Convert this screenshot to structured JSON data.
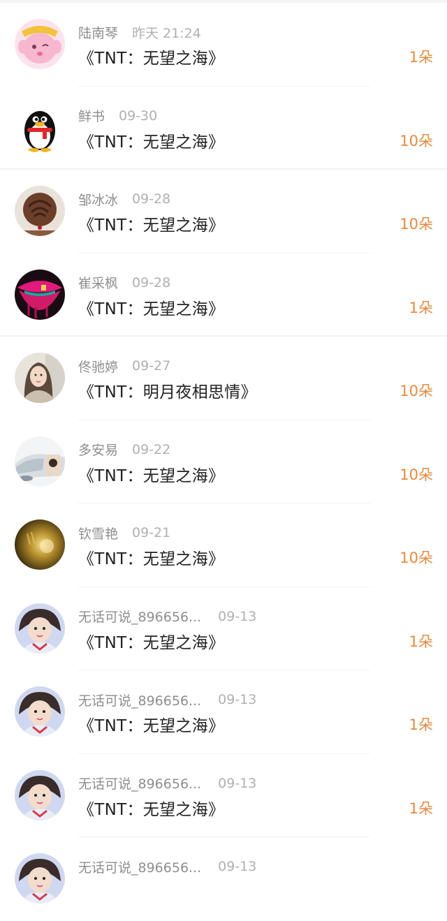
{
  "items": [
    {
      "name": "陆南琴",
      "date": "昨天 21:24",
      "title": "《TNT：无望之海》",
      "count": "1朵",
      "avatar": "pink-cartoon-avatar"
    },
    {
      "name": "鲜书",
      "date": "09-30",
      "title": "《TNT：无望之海》",
      "count": "10朵",
      "avatar": "qq-penguin-avatar"
    },
    {
      "name": "邹冰冰",
      "date": "09-28",
      "title": "《TNT：无望之海》",
      "count": "10朵",
      "avatar": "brown-rose-avatar"
    },
    {
      "name": "崔采枫",
      "date": "09-28",
      "title": "《TNT：无望之海》",
      "count": "1朵",
      "avatar": "pink-lips-avatar"
    },
    {
      "name": "佟驰婷",
      "date": "09-27",
      "title": "《TNT：明月夜相思情》",
      "count": "10朵",
      "avatar": "girl-photo-avatar"
    },
    {
      "name": "多安易",
      "date": "09-22",
      "title": "《TNT：无望之海》",
      "count": "10朵",
      "avatar": "car-photo-avatar"
    },
    {
      "name": "钦雪艳",
      "date": "09-21",
      "title": "《TNT：无望之海》",
      "count": "10朵",
      "avatar": "golden-glow-avatar"
    },
    {
      "name": "无话可说_896656...",
      "date": "09-13",
      "title": "《TNT：无望之海》",
      "count": "1朵",
      "avatar": "child-photo-avatar"
    },
    {
      "name": "无话可说_896656...",
      "date": "09-13",
      "title": "《TNT：无望之海》",
      "count": "1朵",
      "avatar": "child-photo-avatar"
    },
    {
      "name": "无话可说_896656...",
      "date": "09-13",
      "title": "《TNT：无望之海》",
      "count": "1朵",
      "avatar": "child-photo-avatar"
    },
    {
      "name": "无话可说_896656...",
      "date": "09-13",
      "title": "",
      "count": "",
      "avatar": "child-photo-avatar"
    }
  ],
  "colors": {
    "accent": "#e48a40",
    "name_text": "#8e8e8e",
    "title_text": "#222222"
  }
}
